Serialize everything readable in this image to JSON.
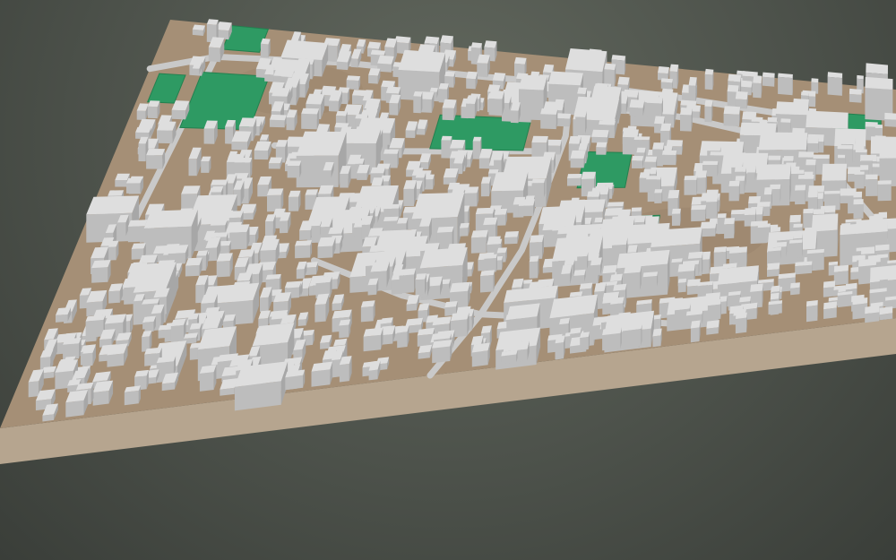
{
  "scene": {
    "kind": "3d-city-block-model",
    "colors": {
      "background": "#50554f",
      "terrain_top": "#a58f76",
      "terrain_side": "#b6a58f",
      "terrain_side_dark": "#8f7e68",
      "building_top": "#dedede",
      "building_left": "#bdbdbd",
      "building_right": "#a7a7a7",
      "road": "#c9c9c9",
      "park": "#2e9a63",
      "park_dark": "#23804f",
      "water": "#7fa8d8"
    },
    "parks": [
      {
        "name": "park-northwest-top"
      },
      {
        "name": "park-northwest-large"
      },
      {
        "name": "park-west-small"
      },
      {
        "name": "park-central-north"
      },
      {
        "name": "park-central-east"
      },
      {
        "name": "park-east-edge"
      },
      {
        "name": "park-east-small"
      }
    ],
    "roads": [
      {
        "name": "road-main-north-south"
      },
      {
        "name": "road-northern-east-west"
      },
      {
        "name": "road-west-vertical"
      },
      {
        "name": "road-eastern-arc"
      },
      {
        "name": "road-southern-diagonal"
      },
      {
        "name": "road-central-cross"
      }
    ]
  }
}
